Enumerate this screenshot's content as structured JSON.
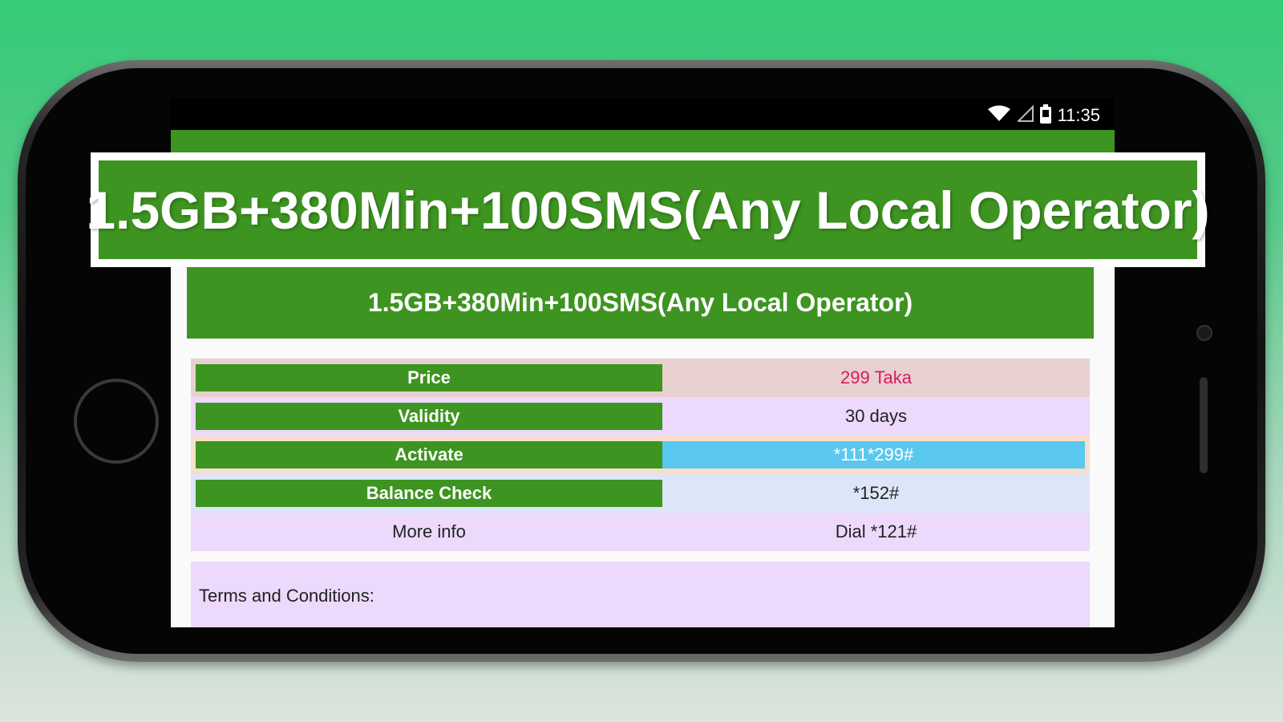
{
  "status_bar": {
    "time": "11:35",
    "icons": [
      "wifi-icon",
      "signal-icon",
      "battery-icon"
    ]
  },
  "banner": {
    "text": "1.5GB+380Min+100SMS(Any Local Operator)"
  },
  "package": {
    "title": "1.5GB+380Min+100SMS(Any Local Operator)",
    "rows": [
      {
        "label": "Price",
        "value": "299 Taka"
      },
      {
        "label": "Validity",
        "value": "30 days"
      },
      {
        "label": "Activate",
        "value": "*111*299#"
      },
      {
        "label": "Balance Check",
        "value": "*152#"
      },
      {
        "label": "More info",
        "value": "Dial *121#"
      }
    ],
    "terms_label": "Terms and Conditions:"
  },
  "colors": {
    "accent_green": "#3d9420",
    "price_color": "#d81b60",
    "activate_highlight": "#5bc8ef",
    "background_top": "#35cb78"
  }
}
